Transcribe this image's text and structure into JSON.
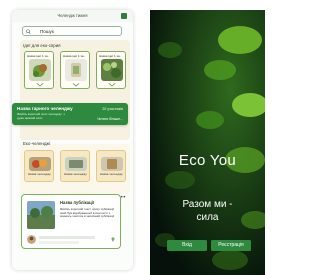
{
  "left_screen": {
    "header_title": "Челендж тижня",
    "search_text": "Пошук",
    "section1_title": "Ідеї для еко-сприя",
    "idea_cards": [
      {
        "label": "Назва ідеї 1 за..."
      },
      {
        "label": "Назва ідеї 1 за..."
      },
      {
        "label": "Назва ідеї 1 за..."
      }
    ],
    "banner": {
      "title": "Назва гарного челенджу",
      "count": "20 учасників",
      "description": "Якийсь короткий опис челенджу: з дуже цікавий опис",
      "more": "Читати більше..."
    },
    "section2_title": "Еко-челенджі",
    "eco_cards": [
      {
        "label": "Назва челенджу"
      },
      {
        "label": "Назва челенджу"
      },
      {
        "label": "Назва челенджу"
      }
    ],
    "publication": {
      "title": "Назва публікації",
      "text": "Якийсь короткий текст опису публікації який був відображеньб в контексті з якимось текстом в записаній публікації"
    },
    "colors": {
      "accent": "#2e8a3e",
      "card_border": "#7fae5a",
      "section_bg": "#f7f1e2"
    }
  },
  "right_screen": {
    "brand": "Eco You",
    "tagline_line1": "Разом ми -",
    "tagline_line2": "сила",
    "login_label": "Вхід",
    "register_label": "Реєстрація"
  }
}
